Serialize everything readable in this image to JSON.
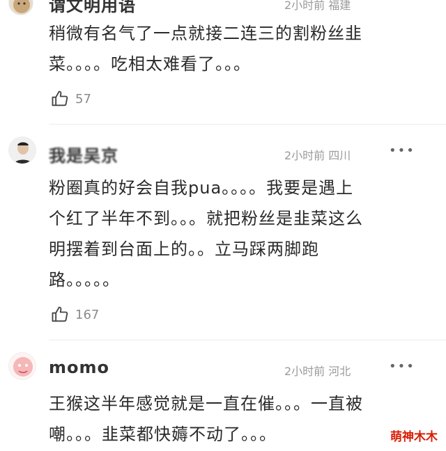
{
  "comments": [
    {
      "username": "谓文明用语",
      "meta": "2小时前 福建",
      "text_lines": [
        "稍微有名气了一点就接二连三的割粉丝韭",
        "菜。。。。吃相太难看了。。。"
      ],
      "likes": "57",
      "avatar_icon": "dog-avatar-icon"
    },
    {
      "username": "我是吴京",
      "meta": "2小时前 四川",
      "more": "•••",
      "text_lines": [
        "粉圈真的好会自我pua。。。。我要是遇上",
        "个红了半年不到。。。就把粉丝是韭菜这么",
        "明摆着到台面上的。。立马踩两脚跑",
        "路。。。。。"
      ],
      "likes": "167",
      "avatar_icon": "man-avatar-icon"
    },
    {
      "username": "momo",
      "meta": "2小时前 河北",
      "more": "•••",
      "text_lines": [
        "王猴这半年感觉就是一直在催。。。一直被",
        "嘲。。。韭菜都快薅不动了。。。"
      ],
      "avatar_icon": "pink-cartoon-avatar-icon"
    }
  ],
  "watermark": "萌神木木",
  "colors": {
    "watermark": "#d81e06",
    "meta": "#9a9a9a",
    "text": "#2a2a2a"
  }
}
